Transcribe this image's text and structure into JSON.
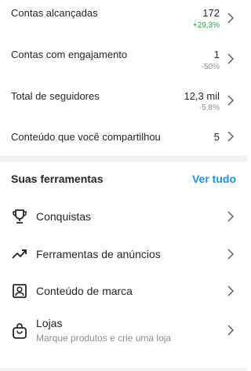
{
  "stats": [
    {
      "label": "Contas alcançadas",
      "value": "172",
      "delta": "+29,3%",
      "delta_color": "#2e9e3f"
    },
    {
      "label": "Contas com engajamento",
      "value": "1",
      "delta": "-50%",
      "delta_color": "#8e8e8e"
    },
    {
      "label": "Total de seguidores",
      "value": "12,3 mil",
      "delta": "-5,8%",
      "delta_color": "#8e8e8e"
    },
    {
      "label": "Conteúdo que você compartilhou",
      "value": "5",
      "delta": "",
      "delta_color": "#8e8e8e"
    }
  ],
  "tools": {
    "title": "Suas ferramentas",
    "see_all": "Ver tudo",
    "accent": "#1f8fe0",
    "items": [
      {
        "label": "Conquistas",
        "icon": "trophy-icon",
        "subtitle": ""
      },
      {
        "label": "Ferramentas de anúncios",
        "icon": "trend-arrow-icon",
        "subtitle": ""
      },
      {
        "label": "Conteúdo de marca",
        "icon": "branded-content-icon",
        "subtitle": ""
      },
      {
        "label": "Lojas",
        "icon": "shopping-bag-icon",
        "subtitle": "Marque produtos e crie uma loja"
      }
    ]
  }
}
